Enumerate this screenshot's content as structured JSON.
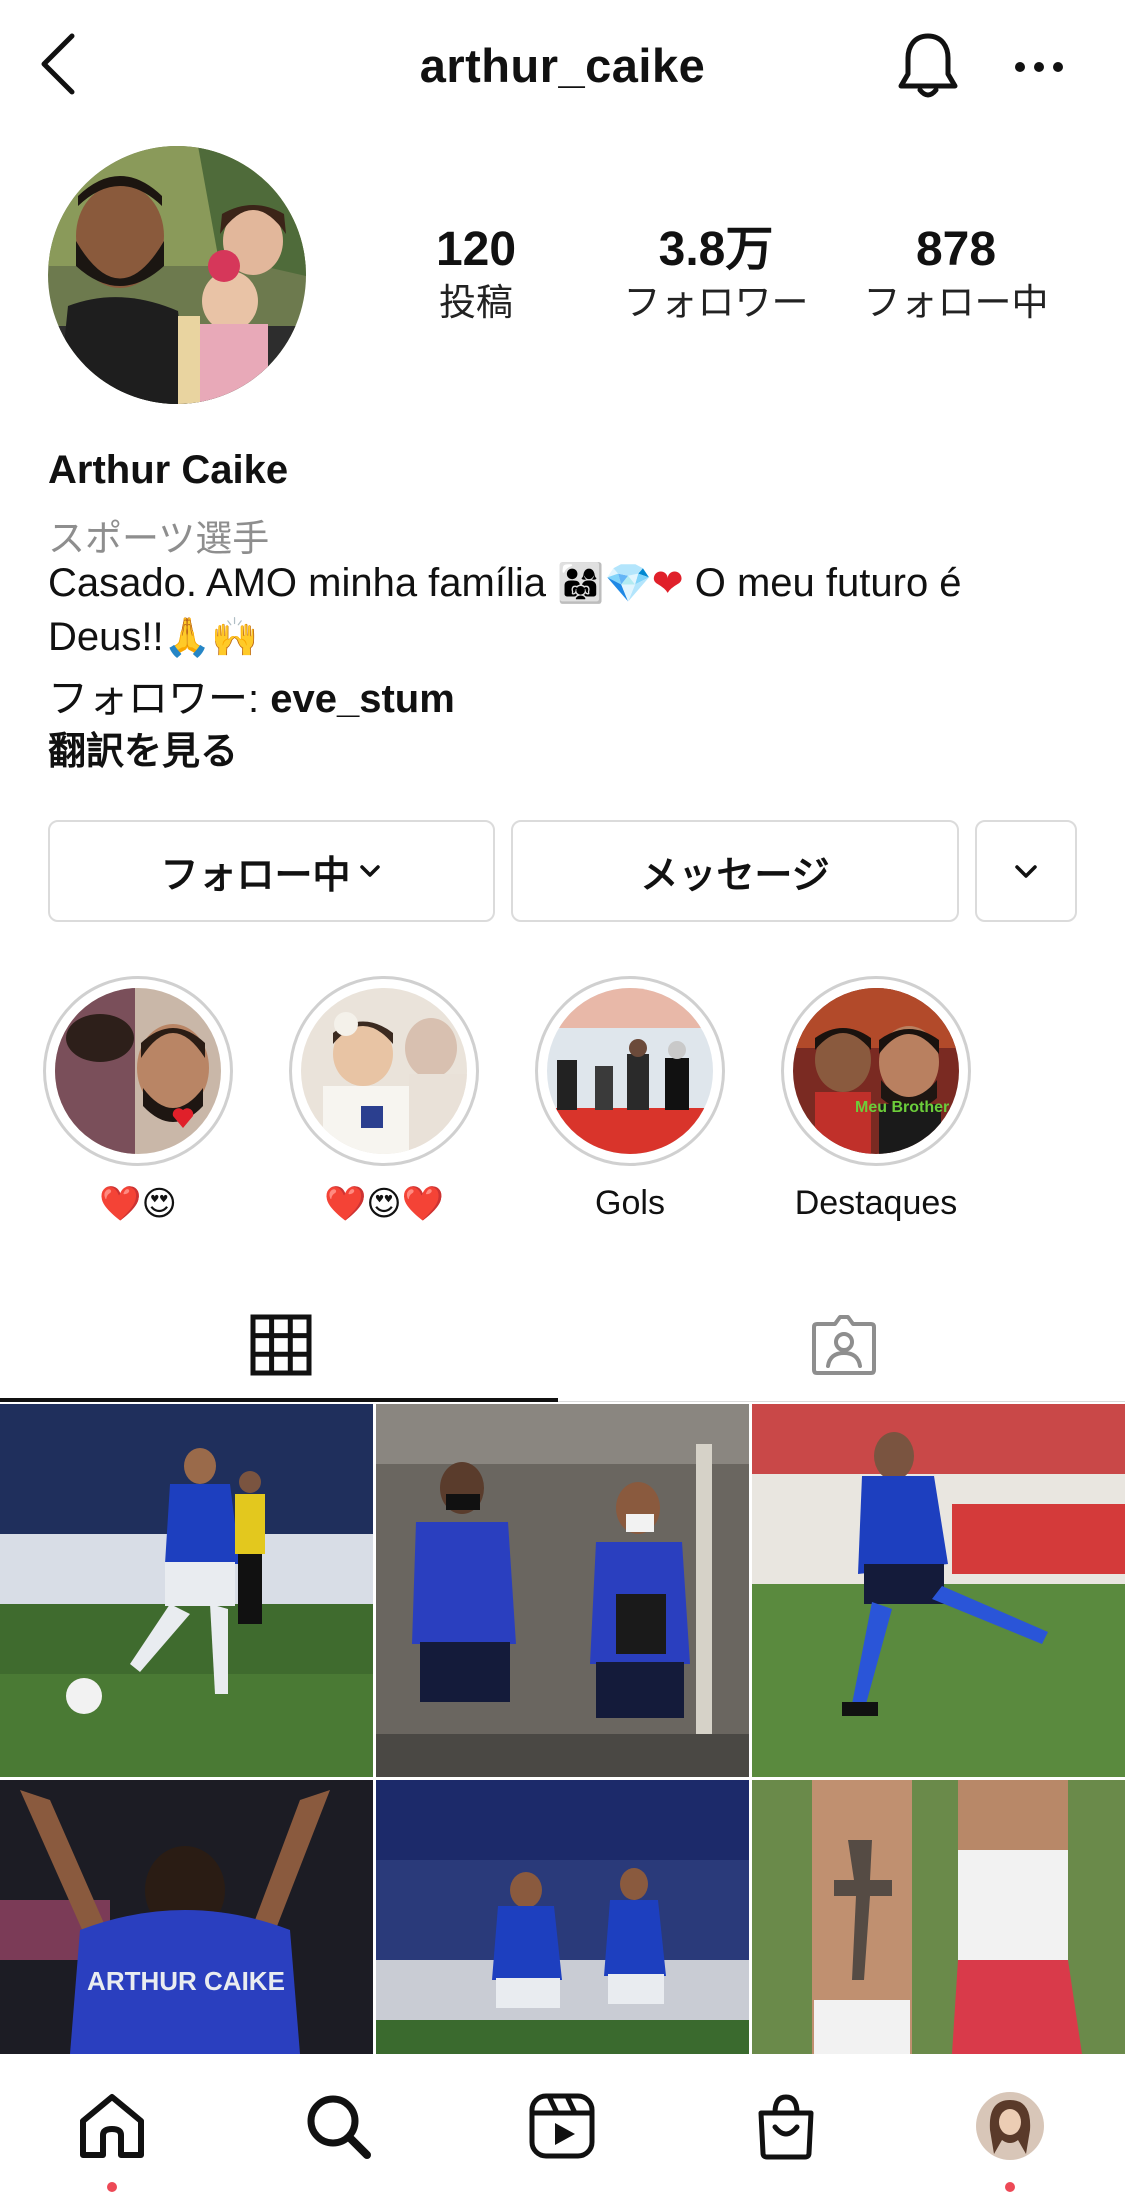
{
  "header": {
    "username": "arthur_caike"
  },
  "profile": {
    "posts_count": "120",
    "posts_label": "投稿",
    "followers_count": "3.8万",
    "followers_label": "フォロワー",
    "following_count": "878",
    "following_label": "フォロー中",
    "name": "Arthur Caike",
    "category": "スポーツ選手",
    "bio_line1": "Casado. AMO minha família",
    "bio_line1_end": "O meu futuro é",
    "bio_line2": "Deus!!",
    "followed_by_prefix": "フォロワー: ",
    "followed_by_user": "eve_stum",
    "translate_label": "翻訳を見る"
  },
  "buttons": {
    "following_label": "フォロー中",
    "message_label": "メッセージ"
  },
  "highlights": [
    {
      "label": "❤️😍"
    },
    {
      "label": "❤️😍❤️"
    },
    {
      "label": "Gols"
    },
    {
      "label": "Destaques"
    }
  ],
  "highlight_overlays": {
    "brother_text": "Meu Brother"
  },
  "grid_overlays": {
    "jersey_name": "ARTHUR CAIKE"
  },
  "colors": {
    "notification_dot": "#ed4956",
    "secondary_text": "#8e8e8e",
    "border": "#dbdbdb"
  },
  "icons": {
    "back": "chevron-left-icon",
    "bell": "bell-icon",
    "more": "ellipsis-icon",
    "grid": "grid-icon",
    "tagged": "tagged-person-icon",
    "home": "home-icon",
    "search": "search-icon",
    "reels": "reels-icon",
    "shop": "shop-bag-icon",
    "profile": "profile-avatar-icon"
  }
}
